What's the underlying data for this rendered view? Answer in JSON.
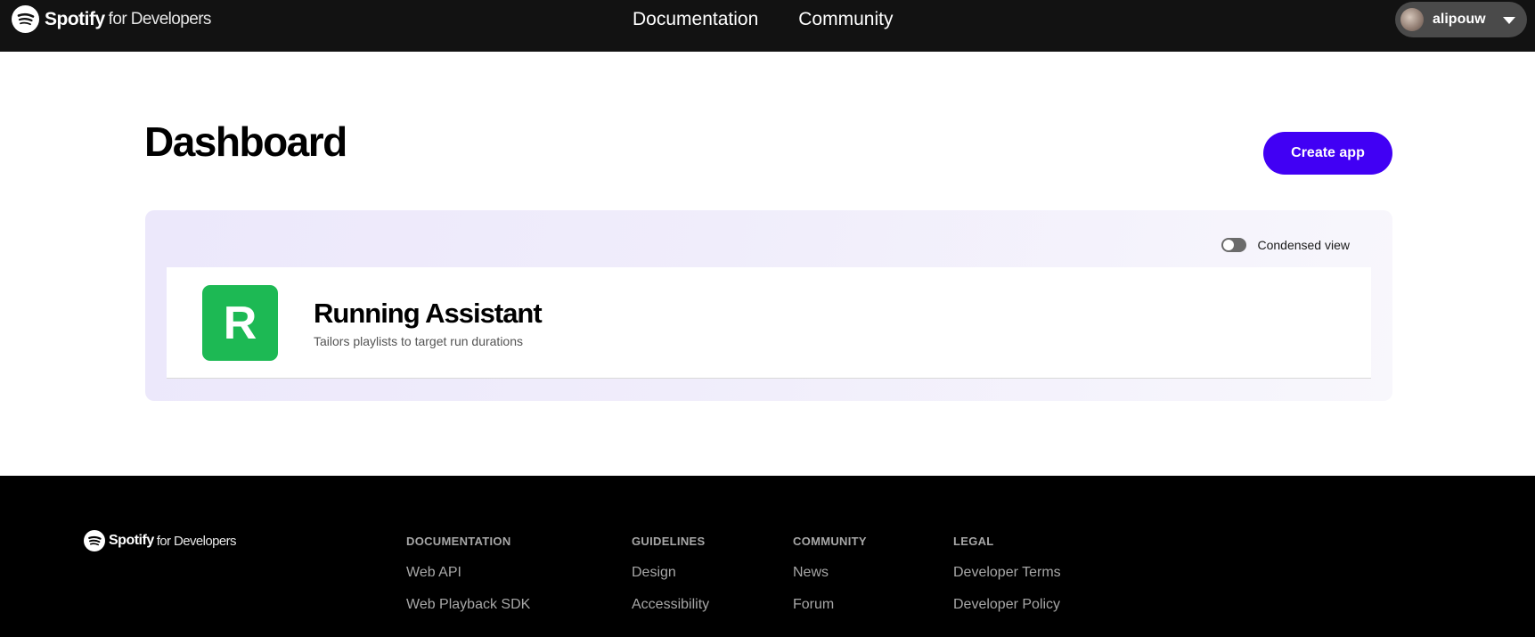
{
  "header": {
    "brand_name": "Spotify",
    "brand_sub": "for Developers",
    "nav": [
      "Documentation",
      "Community"
    ],
    "username": "alipouw"
  },
  "main": {
    "title": "Dashboard",
    "create_button": "Create app",
    "condensed_view_label": "Condensed view",
    "condensed_view_on": false,
    "apps": [
      {
        "initial": "R",
        "name": "Running Assistant",
        "description": "Tailors playlists to target run durations",
        "tile_color": "#1db954"
      }
    ]
  },
  "footer": {
    "brand_name": "Spotify",
    "brand_sub": "for Developers",
    "columns": [
      {
        "heading": "DOCUMENTATION",
        "links": [
          "Web API",
          "Web Playback SDK"
        ]
      },
      {
        "heading": "GUIDELINES",
        "links": [
          "Design",
          "Accessibility"
        ]
      },
      {
        "heading": "COMMUNITY",
        "links": [
          "News",
          "Forum"
        ]
      },
      {
        "heading": "LEGAL",
        "links": [
          "Developer Terms",
          "Developer Policy"
        ]
      }
    ]
  },
  "colors": {
    "accent": "#4100f4",
    "app_tile": "#1db954",
    "header_bg": "#121212",
    "footer_bg": "#000000"
  }
}
